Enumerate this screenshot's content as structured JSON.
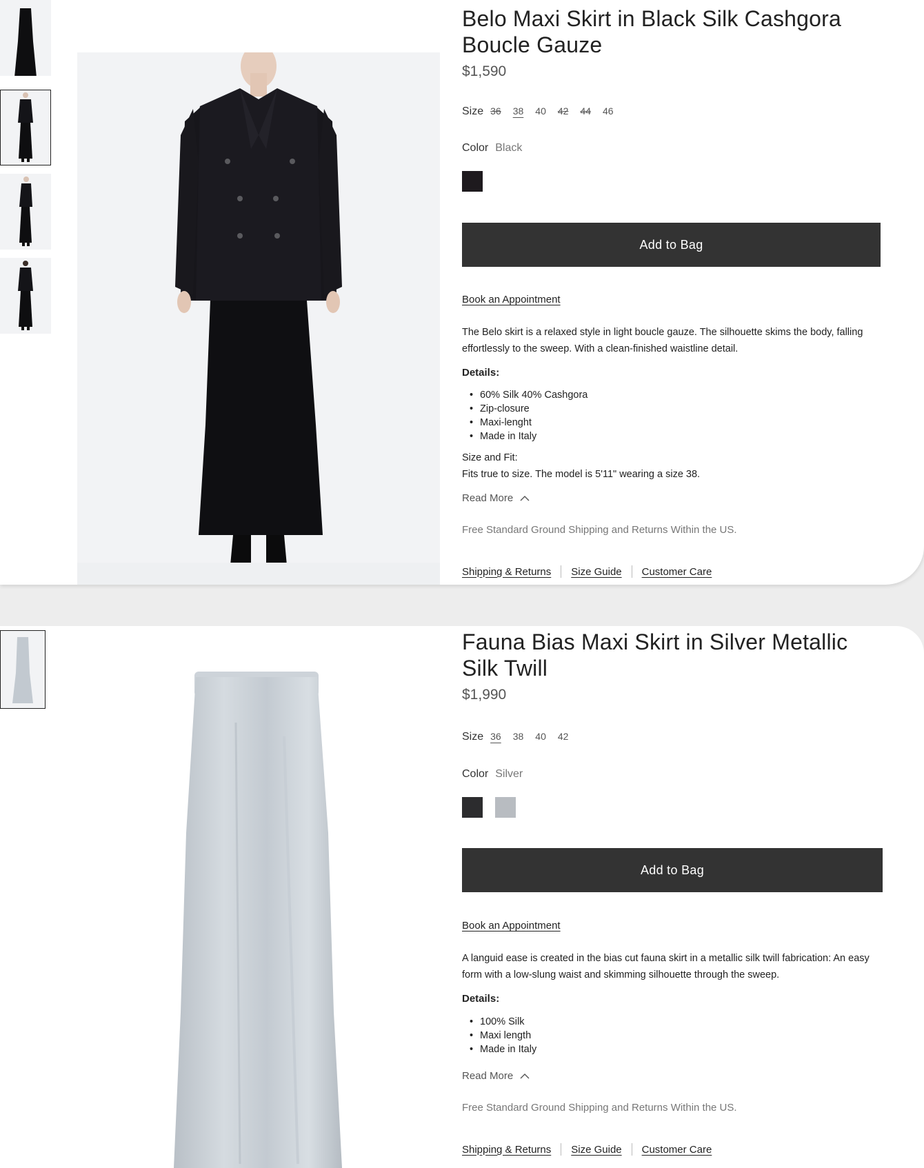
{
  "products": [
    {
      "title": "Belo Maxi Skirt in Black Silk Cashgora Boucle Gauze",
      "price": "$1,590",
      "size_label": "Size",
      "sizes": [
        {
          "label": "36",
          "state": "unavailable"
        },
        {
          "label": "38",
          "state": "selected"
        },
        {
          "label": "40",
          "state": "available"
        },
        {
          "label": "42",
          "state": "unavailable"
        },
        {
          "label": "44",
          "state": "unavailable"
        },
        {
          "label": "46",
          "state": "available"
        }
      ],
      "color_label": "Color",
      "color_value": "Black",
      "swatches": [
        "#1e1a1e"
      ],
      "add_to_bag": "Add to Bag",
      "book_appointment": "Book an Appointment",
      "description": "The Belo skirt is a relaxed style in light boucle gauze. The silhouette skims the body, falling effortlessly to the sweep. With a clean-finished waistline detail.",
      "details_heading": "Details:",
      "details": [
        "60% Silk 40% Cashgora",
        "Zip-closure",
        "Maxi-lenght",
        "Made in Italy"
      ],
      "fit_heading": "Size and Fit:",
      "fit_text": "Fits true to size. The model is 5'11\" wearing a size 38.",
      "read_more": "Read More",
      "shipping_note": "Free Standard Ground Shipping and Returns Within the US.",
      "links": [
        "Shipping & Returns",
        "Size Guide",
        "Customer Care"
      ]
    },
    {
      "title": "Fauna Bias Maxi Skirt in Silver Metallic Silk Twill",
      "price": "$1,990",
      "size_label": "Size",
      "sizes": [
        {
          "label": "36",
          "state": "selected"
        },
        {
          "label": "38",
          "state": "available"
        },
        {
          "label": "40",
          "state": "available"
        },
        {
          "label": "42",
          "state": "available"
        }
      ],
      "color_label": "Color",
      "color_value": "Silver",
      "swatches": [
        "#2c2c2e",
        "#b8bcc1"
      ],
      "add_to_bag": "Add to Bag",
      "book_appointment": "Book an Appointment",
      "description": "A languid ease is created in the bias cut fauna skirt in a metallic silk twill fabrication: An easy form with a low-slung waist and skimming silhouette through the sweep.",
      "details_heading": "Details:",
      "details": [
        "100% Silk",
        "Maxi length",
        "Made in Italy"
      ],
      "read_more": "Read More",
      "shipping_note": "Free Standard Ground Shipping and Returns Within the US.",
      "links": [
        "Shipping & Returns",
        "Size Guide",
        "Customer Care"
      ]
    }
  ],
  "icons": {
    "read_more_chevron": "chevron-up-icon"
  },
  "colors": {
    "button_bg": "#333333",
    "page_bg": "#ededed",
    "card_bg": "#ffffff",
    "image_bg": "#f2f3f5"
  }
}
